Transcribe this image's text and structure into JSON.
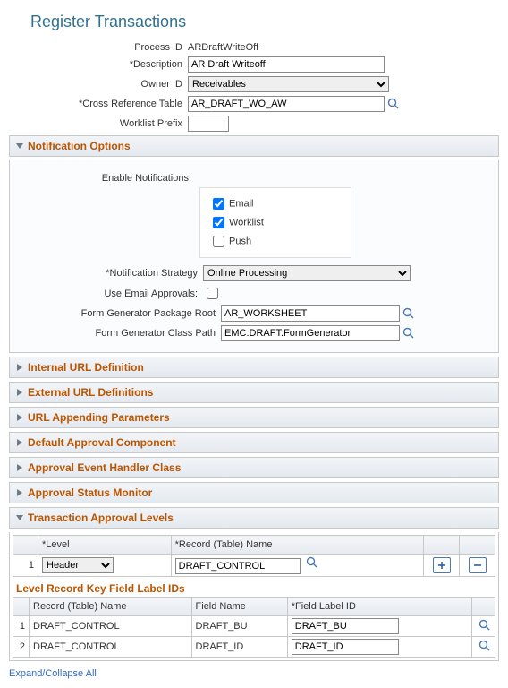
{
  "page_title": "Register Transactions",
  "header": {
    "process_id_label": "Process ID",
    "process_id_value": "ARDraftWriteOff",
    "description_label": "*Description",
    "description_value": "AR Draft Writeoff",
    "owner_id_label": "Owner ID",
    "owner_id_value": "Receivables",
    "cross_ref_label": "*Cross Reference Table",
    "cross_ref_value": "AR_DRAFT_WO_AW",
    "worklist_prefix_label": "Worklist Prefix",
    "worklist_prefix_value": ""
  },
  "sections": {
    "notification_options": "Notification Options",
    "internal_url": "Internal URL Definition",
    "external_url": "External URL Definitions",
    "url_appending": "URL Appending Parameters",
    "default_approval": "Default Approval Component",
    "approval_event": "Approval Event Handler Class",
    "approval_status": "Approval Status Monitor",
    "transaction_levels": "Transaction Approval Levels"
  },
  "notif": {
    "enable_label": "Enable Notifications",
    "email": "Email",
    "worklist": "Worklist",
    "push": "Push",
    "strategy_label": "*Notification Strategy",
    "strategy_value": "Online Processing",
    "use_email_label": "Use Email Approvals:",
    "pkg_root_label": "Form Generator Package Root",
    "pkg_root_value": "AR_WORKSHEET",
    "class_path_label": "Form Generator Class Path",
    "class_path_value": "EMC:DRAFT:FormGenerator"
  },
  "levels": {
    "col_level": "*Level",
    "col_record": "*Record (Table) Name",
    "row_num": "1",
    "level_value": "Header",
    "record_value": "DRAFT_CONTROL"
  },
  "key_fields": {
    "title": "Level Record Key Field Label IDs",
    "col_record": "Record (Table) Name",
    "col_field": "Field Name",
    "col_label_id": "*Field Label ID",
    "rows": [
      {
        "n": "1",
        "rec": "DRAFT_CONTROL",
        "field": "DRAFT_BU",
        "label": "DRAFT_BU"
      },
      {
        "n": "2",
        "rec": "DRAFT_CONTROL",
        "field": "DRAFT_ID",
        "label": "DRAFT_ID"
      }
    ]
  },
  "footer_link": "Expand/Collapse All"
}
